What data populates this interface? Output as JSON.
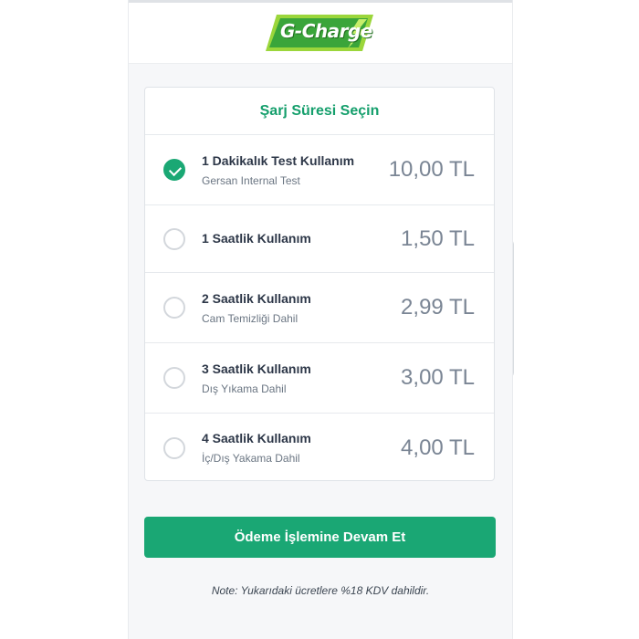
{
  "header": {
    "logo_text": "G-Charge",
    "colors": {
      "logo_green": "#3aa53a",
      "logo_lime": "#9bd63b"
    }
  },
  "card": {
    "title": "Şarj Süresi Seçin",
    "options": [
      {
        "title": "1 Dakikalık Test Kullanım",
        "subtitle": "Gersan Internal Test",
        "price": "10,00 TL",
        "selected": true
      },
      {
        "title": "1 Saatlik Kullanım",
        "subtitle": "",
        "price": "1,50 TL",
        "selected": false
      },
      {
        "title": "2 Saatlik Kullanım",
        "subtitle": "Cam Temizliği Dahil",
        "price": "2,99 TL",
        "selected": false
      },
      {
        "title": "3 Saatlik Kullanım",
        "subtitle": "Dış Yıkama Dahil",
        "price": "3,00 TL",
        "selected": false
      },
      {
        "title": "4 Saatlik Kullanım",
        "subtitle": "İç/Dış Yakama Dahil",
        "price": "4,00 TL",
        "selected": false
      }
    ]
  },
  "actions": {
    "continue_label": "Ödeme İşlemine Devam Et"
  },
  "footer": {
    "note": "Note: Yukarıdaki ücretlere %18 KDV dahildir."
  },
  "colors": {
    "accent": "#1aa774",
    "title_green": "#159f6c",
    "price_gray": "#7a8594"
  }
}
